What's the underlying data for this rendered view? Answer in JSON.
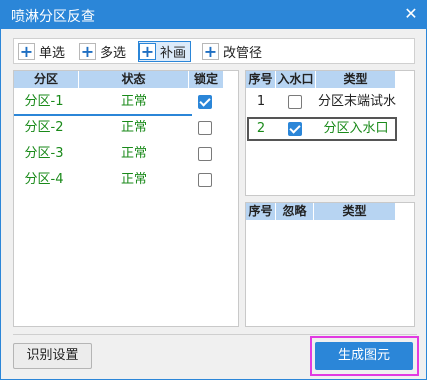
{
  "window": {
    "title": "喷淋分区反查"
  },
  "toolbar": {
    "items": [
      {
        "label": "单选"
      },
      {
        "label": "多选"
      },
      {
        "label": "补画"
      },
      {
        "label": "改管径"
      }
    ]
  },
  "zone_table": {
    "headers": [
      "分区",
      "状态",
      "锁定"
    ],
    "rows": [
      {
        "zone": "分区-1",
        "status": "正常",
        "locked": true
      },
      {
        "zone": "分区-2",
        "status": "正常",
        "locked": false
      },
      {
        "zone": "分区-3",
        "status": "正常",
        "locked": false
      },
      {
        "zone": "分区-4",
        "status": "正常",
        "locked": false
      }
    ]
  },
  "type_table": {
    "headers": [
      "序号",
      "入水口",
      "类型"
    ],
    "rows": [
      {
        "index": "1",
        "inlet": false,
        "type": "分区末端试水"
      },
      {
        "index": "2",
        "inlet": true,
        "type": "分区入水口"
      }
    ]
  },
  "ignore_table": {
    "headers": [
      "序号",
      "忽略",
      "类型"
    ]
  },
  "buttons": {
    "settings_label": "识别设置",
    "generate_label": "生成图元"
  },
  "colors": {
    "accent": "#2b86d8",
    "header_bg": "#b7d4f2",
    "ok_text": "#1a8a1a",
    "highlight": "#e23ae2"
  }
}
